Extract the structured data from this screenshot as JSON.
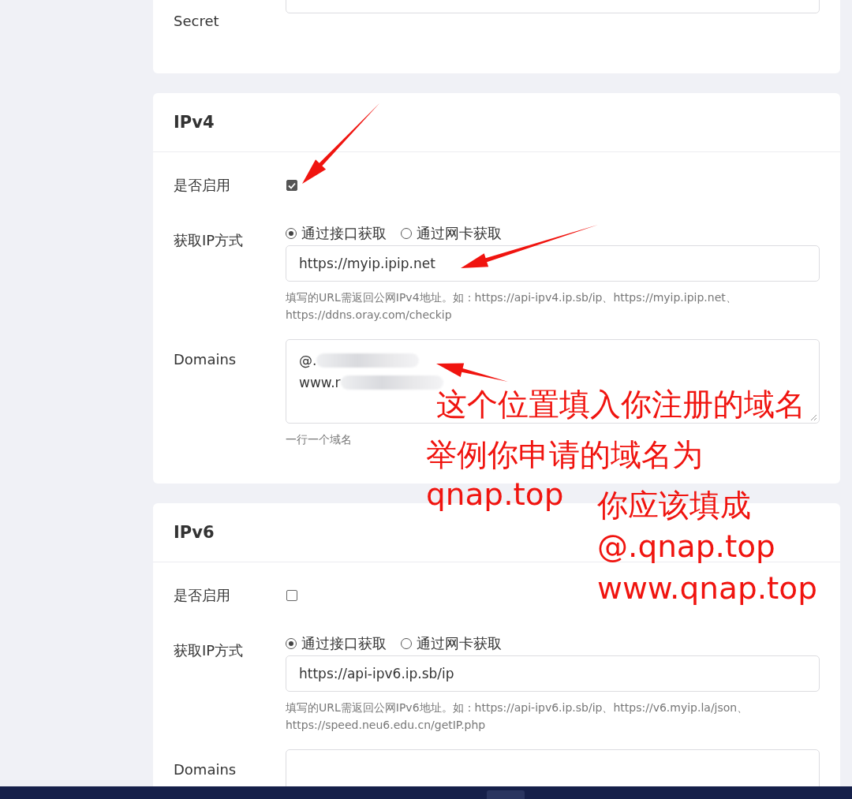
{
  "sections": [
    {
      "kind": "credentials",
      "label": "Secret"
    },
    {
      "kind": "ip",
      "title": "IPv4",
      "enable_label": "是否启用",
      "enabled": true,
      "method_label": "获取IP方式",
      "methods": [
        {
          "label": "通过接口获取",
          "selected": true
        },
        {
          "label": "通过网卡获取",
          "selected": false
        }
      ],
      "url": "https://myip.ipip.net",
      "url_help": "填写的URL需返回公网IPv4地址。如：https://api-ipv4.ip.sb/ip、https://myip.ipip.net、https://ddns.oray.com/checkip",
      "domains_label": "Domains",
      "domains": [
        "@.",
        "www.r"
      ],
      "domains_help": "一行一个域名"
    },
    {
      "kind": "ip",
      "title": "IPv6",
      "enable_label": "是否启用",
      "enabled": false,
      "method_label": "获取IP方式",
      "methods": [
        {
          "label": "通过接口获取",
          "selected": true
        },
        {
          "label": "通过网卡获取",
          "selected": false
        }
      ],
      "url": "https://api-ipv6.ip.sb/ip",
      "url_help": "填写的URL需返回公网IPv6地址。如：https://api-ipv6.ip.sb/ip、https://v6.myip.la/json、https://speed.neu6.edu.cn/getIP.php",
      "domains_label": "Domains"
    }
  ],
  "annotations": [
    "这个位置填入你注册的域名",
    "举例你申请的域名为",
    "qnap.top",
    "你应该填成",
    "@.qnap.top",
    "www.qnap.top"
  ]
}
